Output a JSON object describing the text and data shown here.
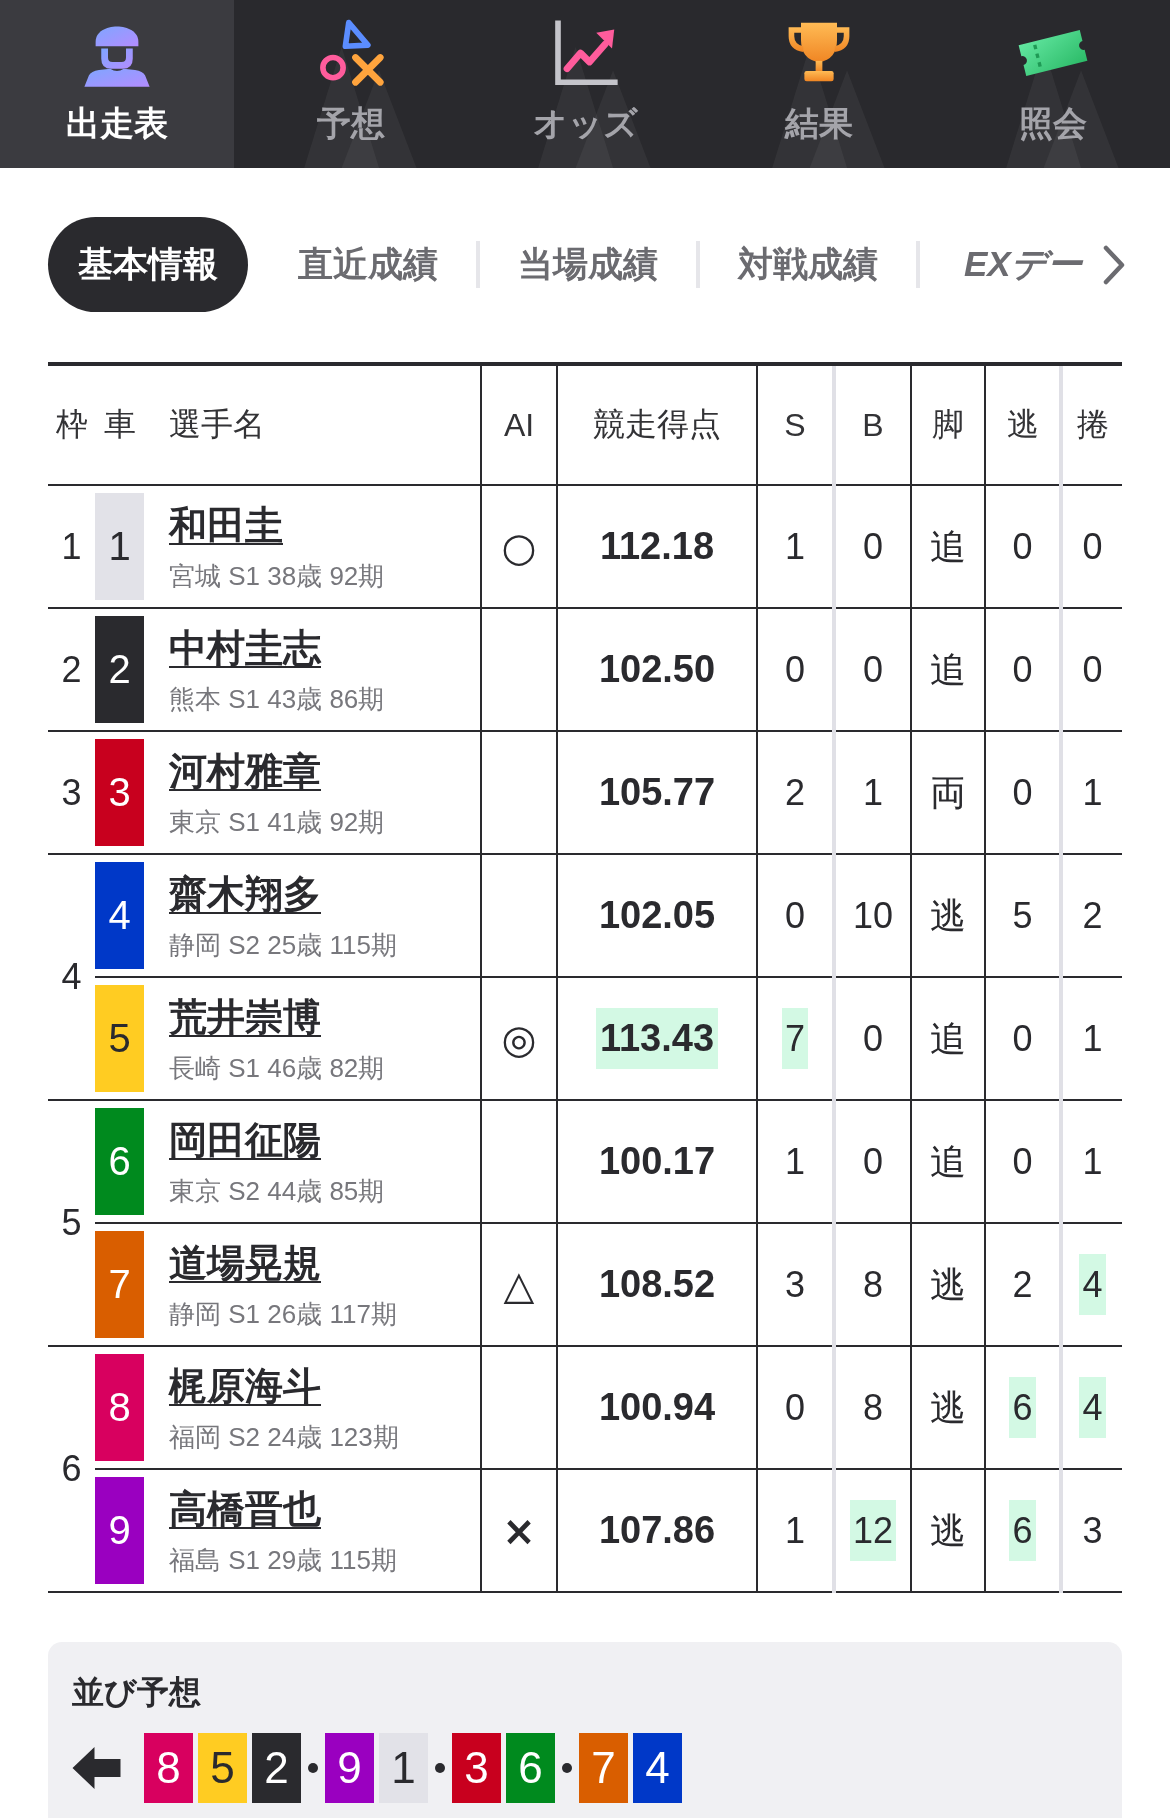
{
  "nav": {
    "tabs": [
      {
        "kind": "entries",
        "label": "出走表",
        "selected": true
      },
      {
        "kind": "forecast",
        "label": "予想",
        "selected": false
      },
      {
        "kind": "odds",
        "label": "オッズ",
        "selected": false
      },
      {
        "kind": "results",
        "label": "結果",
        "selected": false
      },
      {
        "kind": "inquiry",
        "label": "照会",
        "selected": false
      }
    ]
  },
  "sub_tabs": [
    {
      "kind": "text",
      "label": "基本情報",
      "selected": true
    },
    {
      "kind": "text",
      "label": "直近成績",
      "selected": false
    },
    {
      "kind": "text",
      "label": "当場成績",
      "selected": false
    },
    {
      "kind": "text",
      "label": "対戦成績",
      "selected": false
    },
    {
      "kind": "logo",
      "label": "EXデー",
      "selected": false
    }
  ],
  "table": {
    "columns": [
      "枠",
      "車",
      "選手名",
      "AI",
      "競走得点",
      "S",
      "B",
      "脚",
      "逃",
      "捲"
    ],
    "frames": [
      {
        "label": "1",
        "riders": [
          {
            "car": "1",
            "color": "#e2e2e8",
            "name": "和田圭",
            "info": "宮城 S1 38歳 92期",
            "ai_mark": "○",
            "stats": [
              {
                "text": "112.18",
                "highlighted": false
              },
              {
                "text": "1",
                "highlighted": false
              },
              {
                "text": "0",
                "highlighted": false
              },
              {
                "text": "追",
                "highlighted": false
              },
              {
                "text": "0",
                "highlighted": false
              },
              {
                "text": "0",
                "highlighted": false
              }
            ]
          }
        ]
      },
      {
        "label": "2",
        "riders": [
          {
            "car": "2",
            "color": "#2a2a2e",
            "name": "中村圭志",
            "info": "熊本 S1 43歳 86期",
            "stats": [
              {
                "text": "102.50",
                "highlighted": false
              },
              {
                "text": "0",
                "highlighted": false
              },
              {
                "text": "0",
                "highlighted": false
              },
              {
                "text": "追",
                "highlighted": false
              },
              {
                "text": "0",
                "highlighted": false
              },
              {
                "text": "0",
                "highlighted": false
              }
            ]
          }
        ]
      },
      {
        "label": "3",
        "riders": [
          {
            "car": "3",
            "color": "#c8001e",
            "name": "河村雅章",
            "info": "東京 S1 41歳 92期",
            "stats": [
              {
                "text": "105.77",
                "highlighted": false
              },
              {
                "text": "2",
                "highlighted": false
              },
              {
                "text": "1",
                "highlighted": false
              },
              {
                "text": "両",
                "highlighted": false
              },
              {
                "text": "0",
                "highlighted": false
              },
              {
                "text": "1",
                "highlighted": false
              }
            ]
          }
        ]
      },
      {
        "label": "4",
        "riders": [
          {
            "car": "4",
            "color": "#0038c8",
            "name": "齋木翔多",
            "info": "静岡 S2 25歳 115期",
            "stats": [
              {
                "text": "102.05",
                "highlighted": false
              },
              {
                "text": "0",
                "highlighted": false
              },
              {
                "text": "10",
                "highlighted": false
              },
              {
                "text": "逃",
                "highlighted": false
              },
              {
                "text": "5",
                "highlighted": false
              },
              {
                "text": "2",
                "highlighted": false
              }
            ]
          },
          {
            "car": "5",
            "color": "#ffcc22",
            "name": "荒井崇博",
            "info": "長崎 S1 46歳 82期",
            "ai_mark": "◎",
            "stats": [
              {
                "text": "113.43",
                "highlighted": true
              },
              {
                "text": "7",
                "highlighted": true
              },
              {
                "text": "0",
                "highlighted": false
              },
              {
                "text": "追",
                "highlighted": false
              },
              {
                "text": "0",
                "highlighted": false
              },
              {
                "text": "1",
                "highlighted": false
              }
            ]
          }
        ]
      },
      {
        "label": "5",
        "riders": [
          {
            "car": "6",
            "color": "#008a1e",
            "name": "岡田征陽",
            "info": "東京 S2 44歳 85期",
            "stats": [
              {
                "text": "100.17",
                "highlighted": false
              },
              {
                "text": "1",
                "highlighted": false
              },
              {
                "text": "0",
                "highlighted": false
              },
              {
                "text": "追",
                "highlighted": false
              },
              {
                "text": "0",
                "highlighted": false
              },
              {
                "text": "1",
                "highlighted": false
              }
            ]
          },
          {
            "car": "7",
            "color": "#d95e00",
            "name": "道場晃規",
            "info": "静岡 S1 26歳 117期",
            "ai_mark": "△",
            "stats": [
              {
                "text": "108.52",
                "highlighted": false
              },
              {
                "text": "3",
                "highlighted": false
              },
              {
                "text": "8",
                "highlighted": false
              },
              {
                "text": "逃",
                "highlighted": false
              },
              {
                "text": "2",
                "highlighted": false
              },
              {
                "text": "4",
                "highlighted": true
              }
            ]
          }
        ]
      },
      {
        "label": "6",
        "riders": [
          {
            "car": "8",
            "color": "#d8005f",
            "name": "梶原海斗",
            "info": "福岡 S2 24歳 123期",
            "stats": [
              {
                "text": "100.94",
                "highlighted": false
              },
              {
                "text": "0",
                "highlighted": false
              },
              {
                "text": "8",
                "highlighted": false
              },
              {
                "text": "逃",
                "highlighted": false
              },
              {
                "text": "6",
                "highlighted": true
              },
              {
                "text": "4",
                "highlighted": true
              }
            ]
          },
          {
            "car": "9",
            "color": "#9a00c0",
            "name": "高橋晋也",
            "info": "福島 S1 29歳 115期",
            "ai_mark": "×",
            "stats": [
              {
                "text": "107.86",
                "highlighted": false
              },
              {
                "text": "1",
                "highlighted": false
              },
              {
                "text": "12",
                "highlighted": true
              },
              {
                "text": "逃",
                "highlighted": false
              },
              {
                "text": "6",
                "highlighted": true
              },
              {
                "text": "3",
                "highlighted": false
              }
            ]
          }
        ]
      }
    ]
  },
  "lineup": {
    "title": "並び予想",
    "groups": [
      [
        {
          "car": "8",
          "color": "#d8005f"
        },
        {
          "car": "5",
          "color": "#ffcc22"
        },
        {
          "car": "2",
          "color": "#2a2a2e"
        }
      ],
      [
        {
          "car": "9",
          "color": "#9a00c0"
        },
        {
          "car": "1",
          "color": "#e2e2e8"
        }
      ],
      [
        {
          "car": "3",
          "color": "#c8001e"
        },
        {
          "car": "6",
          "color": "#008a1e"
        }
      ],
      [
        {
          "car": "7",
          "color": "#d95e00"
        },
        {
          "car": "4",
          "color": "#0038c8"
        }
      ]
    ]
  }
}
